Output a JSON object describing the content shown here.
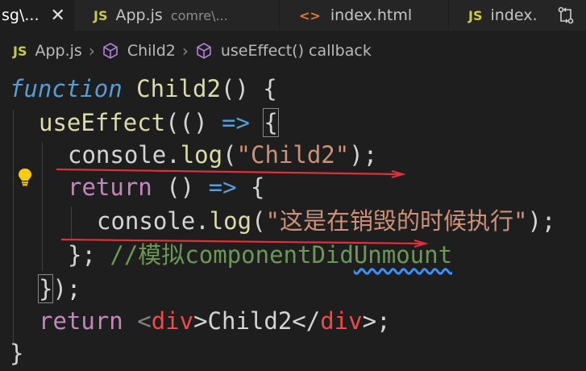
{
  "tabs": [
    {
      "label": "sg\\...",
      "close": "✕"
    },
    {
      "icon": "JS",
      "label": "App.js",
      "subtitle": "comre\\..."
    },
    {
      "icon": "<>",
      "label": "index.html"
    },
    {
      "icon": "JS",
      "label": "index."
    }
  ],
  "breadcrumb": {
    "file_icon": "JS",
    "file": "App.js",
    "item1": "Child2",
    "item2": "useEffect() callback"
  },
  "code": {
    "l1_kw": "function",
    "l1_name": "Child2",
    "l1_rest": "() {",
    "l2_fn": "useEffect",
    "l2_open": "((",
    "l2_close": ")",
    "l2_arrow": "=>",
    "l2_brace": "{",
    "l3_obj": "console.",
    "l3_fn": "log",
    "l3_open": "(",
    "l3_str": "\"Child2\"",
    "l3_close": ");",
    "l4_ret": "return",
    "l4_paren": " () ",
    "l4_arrow": "=>",
    "l4_brace": " {",
    "l5_obj": "console.",
    "l5_fn": "log",
    "l5_open": "(",
    "l5_str": "\"这是在销毁的时候执行\"",
    "l5_close": ");",
    "l6_close": "};",
    "l6_comment_a": " //模拟",
    "l6_comment_b": "componentDid",
    "l6_comment_c": "Unmount",
    "l7_brace": "}",
    "l7_close": ");",
    "l8_ret": "return",
    "l8_lt1": " <",
    "l8_tag1": "div",
    "l8_mid": ">Child2</",
    "l8_tag2": "div",
    "l8_end": ">;",
    "l9": "}"
  },
  "colors": {
    "background": "#1e1e1e",
    "annotation_red": "#e0303a"
  }
}
